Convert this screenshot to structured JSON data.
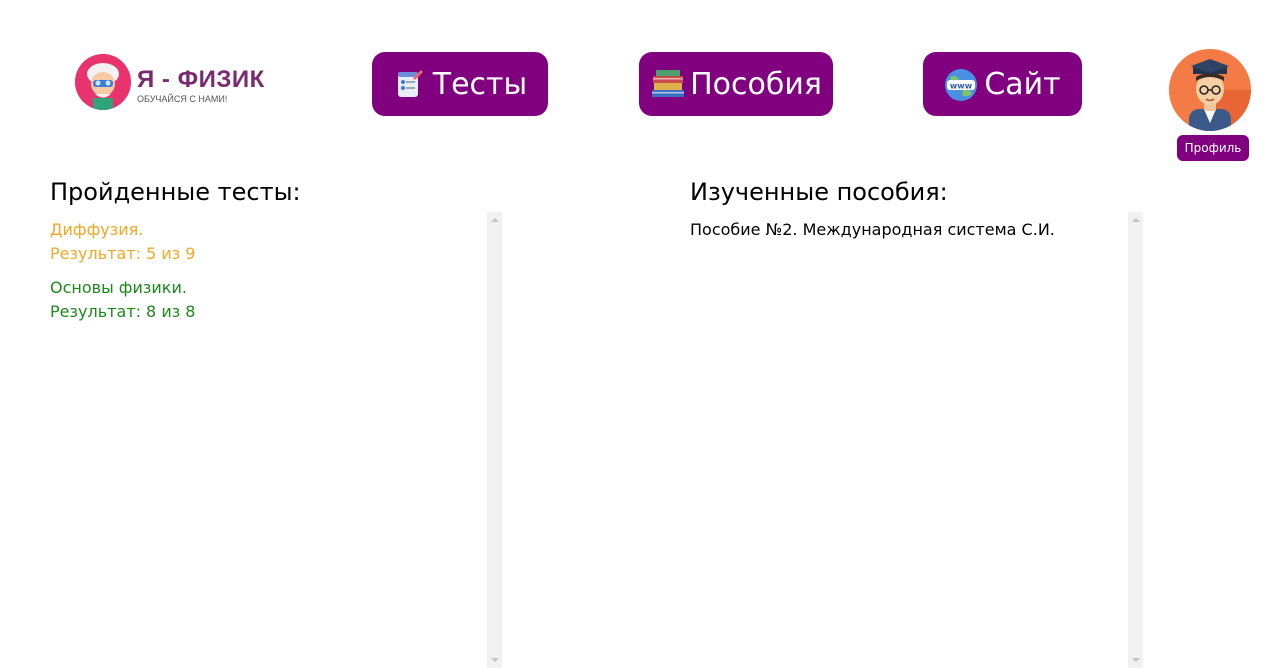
{
  "logo": {
    "title": "Я - ФИЗИК",
    "subtitle": "ОБУЧАЙСЯ С НАМИ!"
  },
  "nav": {
    "tests_label": "Тесты",
    "manuals_label": "Пособия",
    "site_label": "Сайт"
  },
  "profile": {
    "label": "Профиль"
  },
  "tests": {
    "title": "Пройденные тесты:",
    "items": [
      {
        "name": "Диффузия.",
        "result": "Результат: 5 из 9",
        "color": "#f5a623"
      },
      {
        "name": "Основы физики.",
        "result": "Результат: 8 из 8",
        "color": "#1b8a1b"
      }
    ]
  },
  "manuals": {
    "title": "Изученные пособия:",
    "items": [
      {
        "name": "Пособие №2. Международная система С.И."
      }
    ]
  },
  "colors": {
    "accent": "#800080",
    "logo_pink": "#e8336f",
    "avatar_bg": "#f47b45"
  }
}
